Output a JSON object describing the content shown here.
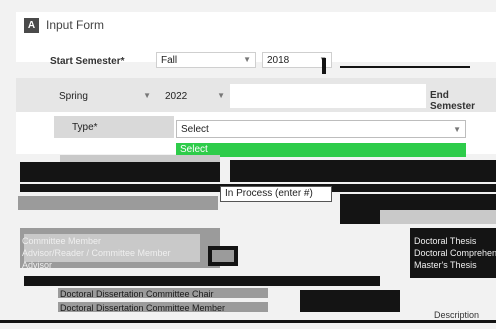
{
  "window": {
    "logo": "A",
    "title": "Input Form"
  },
  "start_semester": {
    "label": "Start Semester*",
    "term_value": "Fall",
    "year_value": "2018"
  },
  "end_semester": {
    "label": "End Semester",
    "term_value": "Spring",
    "year_value": "2022"
  },
  "type_field": {
    "label": "Type*",
    "select_value": "Select",
    "highlighted_option": "Select"
  },
  "glitched_options": {
    "in_process": "In Process (enter #)",
    "list_left": [
      "Committee Member",
      "Advisor/Reader / Committee Member",
      "Advisor"
    ],
    "list_right": [
      "Doctoral Thesis",
      "Doctoral Comprehensive",
      "Master's Thesis"
    ],
    "list_bottom": [
      "Doctoral Dissertation Committee Chair",
      "Doctoral Dissertation Committee Member"
    ],
    "description_label": "Description"
  },
  "colors": {
    "accent_green": "#2ecc4a",
    "glitch_dark": "#141414",
    "panel_bg": "#f2f2f2"
  }
}
